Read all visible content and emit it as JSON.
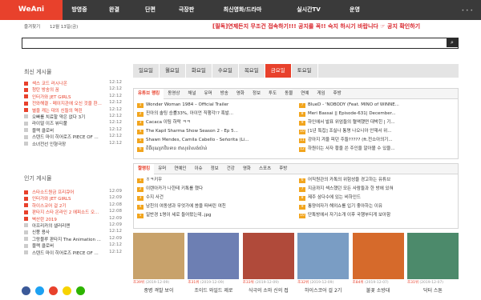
{
  "nav": {
    "logo": "WeAni",
    "menu": [
      "방영중",
      "완결",
      "단편",
      "극장판",
      "최신영화/드라마",
      "실시간TV",
      "운영"
    ]
  },
  "sub": {
    "favorites": "즐겨찾기",
    "date": "12월 13일(금)"
  },
  "notice": "[필독]연제든지 무조건 접속하기!!! 공지를 꼭!! 숙지 하시기 바랍니다 ☞ 공지 확인하기",
  "search": {
    "placeholder": "",
    "icon": "search-icon"
  },
  "recent": {
    "title": "최신 게시물",
    "items": [
      {
        "t": "섹스 코드 러시나온",
        "tm": "12:12",
        "hot": true
      },
      {
        "t": "청탄 방송의 꿈",
        "tm": "12:12",
        "hot": true
      },
      {
        "t": "인터가와 JET GIRLS",
        "tm": "12:12",
        "hot": true
      },
      {
        "t": "전와해결 - 메이지관에 오신 것을 환...",
        "tm": "12:12",
        "hot": true
      },
      {
        "t": "별을 캐는 대의 신들의 역린",
        "tm": "12:12",
        "hot": true
      },
      {
        "t": "오빠를 치료할 약은 없다 3기",
        "tm": "12:12",
        "hot": false
      },
      {
        "t": "라이얼 이즈 뷰티풀",
        "tm": "12:12",
        "hot": false
      },
      {
        "t": "블랙 클로버",
        "tm": "12:12",
        "hot": false
      },
      {
        "t": "스텐드 마이 히어로즈 PIECE OF ...",
        "tm": "12:12",
        "hot": false
      },
      {
        "t": "소녀전선 인형극장",
        "tm": "12:12",
        "hot": false
      }
    ]
  },
  "popular": {
    "title": "인기 게시물",
    "items": [
      {
        "t": "스타소드원금 프리큐어",
        "tm": "12:09",
        "hot": true,
        "badge": "+1"
      },
      {
        "t": "인터가와 JET GIRLS",
        "tm": "12:09",
        "hot": true
      },
      {
        "t": "하이스코어 걸 2기",
        "tm": "12:08",
        "hot": true
      },
      {
        "t": "판타지 스타 온라인 2 에피소드 오...",
        "tm": "12:08",
        "hot": true
      },
      {
        "t": "벽산란 2019",
        "tm": "12:09",
        "hot": true
      },
      {
        "t": "아프리카의 샐러리맨",
        "tm": "12:09",
        "hot": false
      },
      {
        "t": "신쭝 용사",
        "tm": "12:12",
        "hot": false
      },
      {
        "t": "그랑블루 판타지 The Animation ...",
        "tm": "12:09",
        "hot": false
      },
      {
        "t": "블랙 클로버",
        "tm": "12:12",
        "hot": false
      },
      {
        "t": "스텐드 마이 히어로즈 PIECE OF ...",
        "tm": "12:12",
        "hot": false
      }
    ]
  },
  "days": [
    "일요일",
    "월요일",
    "화요일",
    "수요일",
    "목요일",
    "금요일",
    "토요일"
  ],
  "active_day": 5,
  "box1": {
    "tabs": [
      "유튜브 랭킹",
      "동영상",
      "채널",
      "유머",
      "방송",
      "영화",
      "정보",
      "투도",
      "동물",
      "연예",
      "게임",
      "후방"
    ],
    "left": [
      "Wonder Woman 1984 – Official Trailer",
      "진아의 솔팅 승률33%, 아이언 직행각!? 혹발...",
      "Cacaca 이팀 하락 ㅋㅋ",
      "The Kapil Sharma Show Season 2 - Ep 5...",
      "Shawn Mendes, Camila Cabello - Señorita (Li...",
      "ពិធីបុណ្យកឋិនទាន ថាសុខរ៉ាសង់យ៉ាន់"
    ],
    "right": [
      "BlueD - 'NOBODY (Feat. MINO of WINNE...",
      "Meri Bassai || Episode-631| December...",
      "하인에서 발표 위엄들의 혈액했떤 대박힌 | 기...",
      "[1년 특집] 조실나 통명 나오니아 안재서 위...",
      "강아지 겨울 피던 주들????? (ft.전소아의기...",
      "하원이는 사자 황을 쓴 주인을 알아볼 수 있을..."
    ]
  },
  "box2": {
    "tabs": [
      "짤랭킹",
      "유머",
      "연예인",
      "이슈",
      "정보",
      "건강",
      "영화",
      "스포츠",
      "후방"
    ],
    "left": [
      "ㅎㅋ키우",
      "이렌아카가 나한테 키톡를 했다",
      "수지 사건",
      "남친의 여동생과 무엇가에 씀을 떠버린 여친",
      "일반경 1명이 세로 들어왔는데..jpg"
    ],
    "right": [
      "어직원관의 카톡의 위험성을 경고하는 유튜브",
      "지금까지 섹스했던 모든 사람들과 한 방에 있혀",
      "제주 삼다수에 있는 비하인드",
      "통양여자가 해외쇼를 입기 좋아하는 이유",
      "단톡방에서 자기소개 이후 국행부티게 보아함"
    ]
  },
  "thumbs": [
    {
      "cap": "중병 격발 보이",
      "rank": "조39위",
      "date": "(2019-12-09)"
    },
    {
      "cap": "조이드 와일드 제로",
      "rank": "조31위",
      "date": "(2019-12-09)"
    },
    {
      "cap": "식극의 소마 신의 접",
      "rank": "조33위",
      "date": "(2019-12-09)"
    },
    {
      "cap": "하이스코어 걸 2기",
      "rank": "조32위",
      "date": "(2019-12-09)"
    },
    {
      "cap": "불꽃 소방대",
      "rank": "조84위",
      "date": "(2019-12-07)"
    },
    {
      "cap": "닥터 스톤",
      "rank": "조31위",
      "date": "(2019-12-07)"
    }
  ],
  "colors": {
    "accent": "#e8412c",
    "nav": "#3a3a3a"
  }
}
